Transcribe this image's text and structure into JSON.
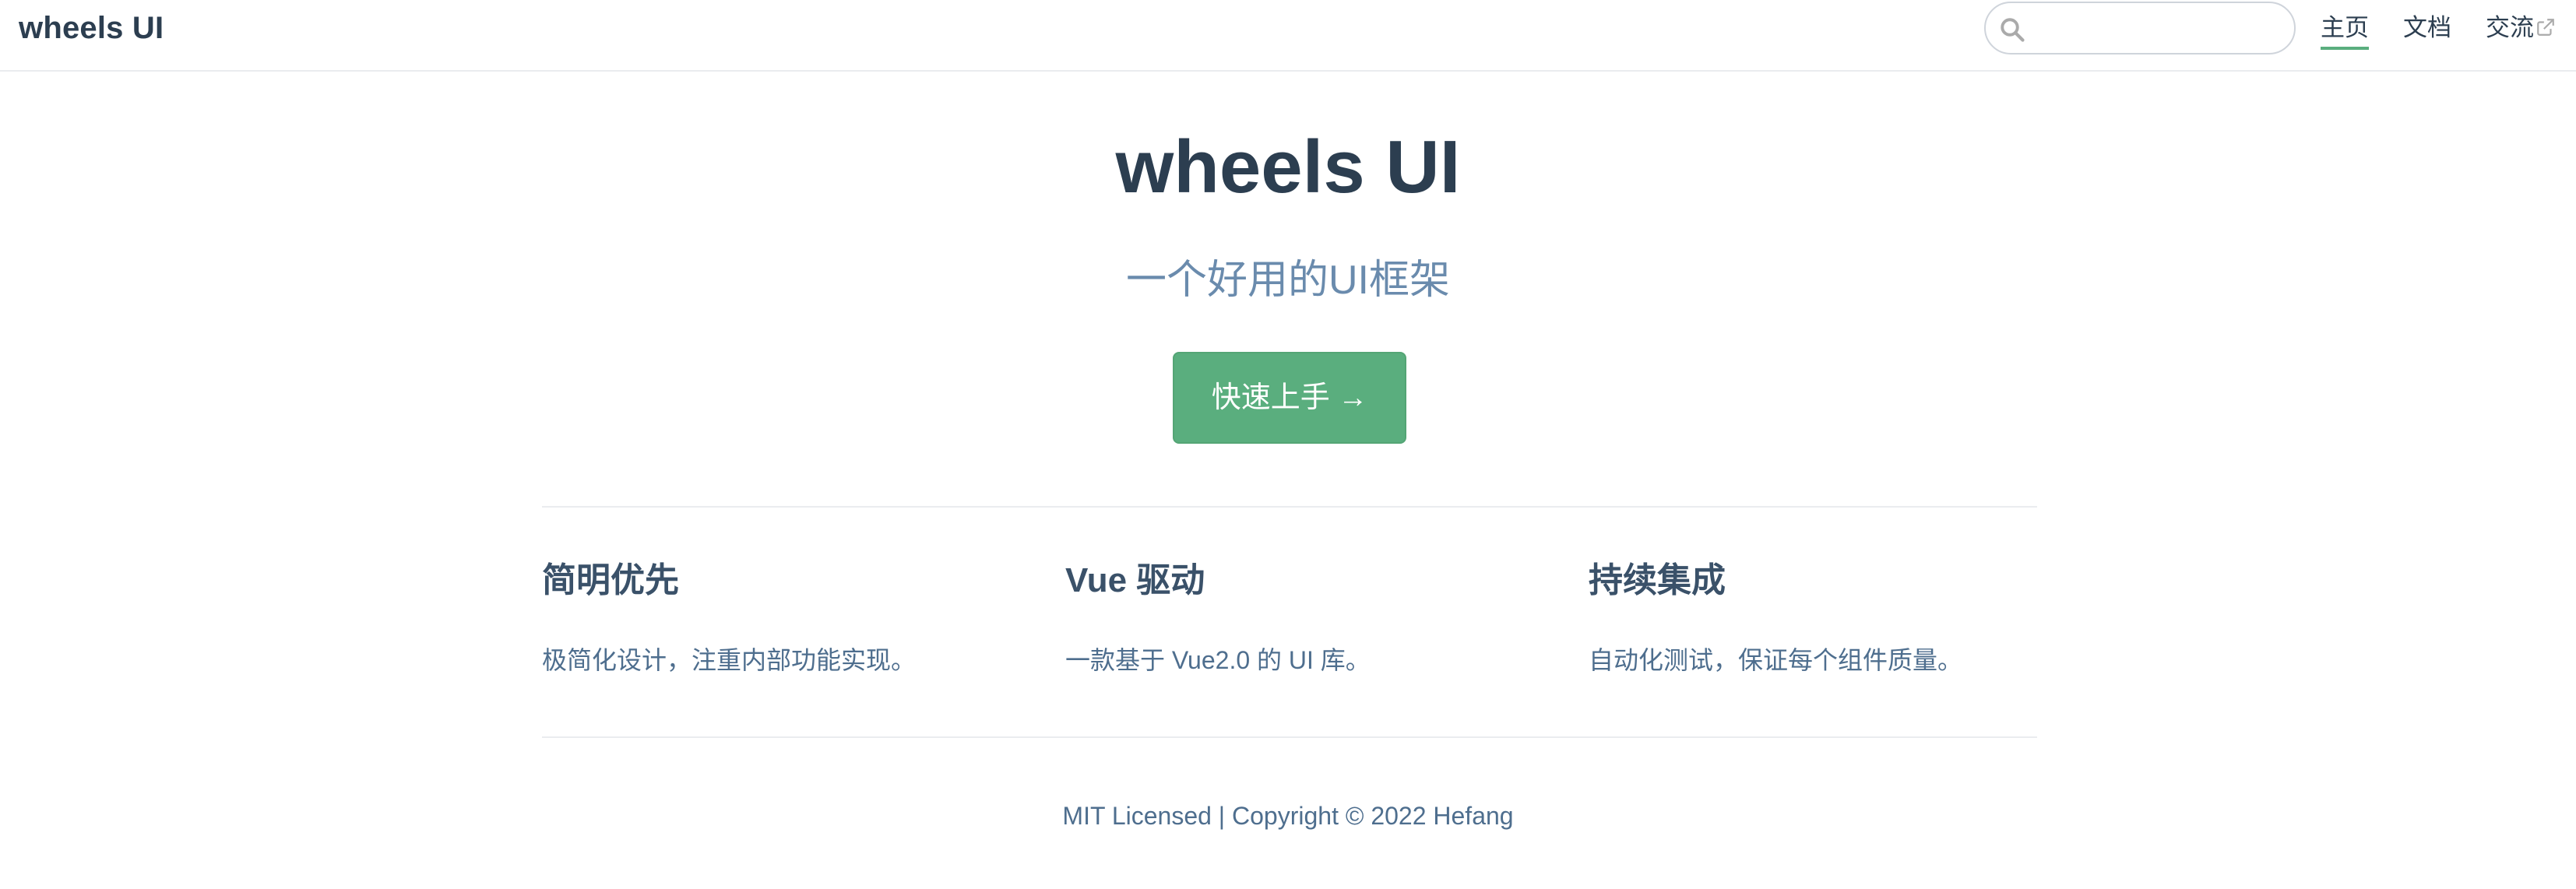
{
  "navbar": {
    "brand": "wheels UI",
    "search": {
      "value": "",
      "placeholder": ""
    },
    "links": [
      {
        "label": "主页",
        "active": true
      },
      {
        "label": "文档",
        "active": false
      },
      {
        "label": "交流",
        "active": false,
        "external": true
      }
    ]
  },
  "hero": {
    "title": "wheels UI",
    "description": "一个好用的UI框架",
    "action_label": "快速上手 →"
  },
  "features": [
    {
      "title": "简明优先",
      "details": "极简化设计，注重内部功能实现。"
    },
    {
      "title": "Vue 驱动",
      "details": "一款基于 Vue2.0 的 UI 库。"
    },
    {
      "title": "持续集成",
      "details": "自动化测试，保证每个组件质量。"
    }
  ],
  "footer": {
    "text": "MIT Licensed | Copyright © 2022 Hefang"
  },
  "colors": {
    "accent": "#5aae7e",
    "text": "#2c3e50",
    "muted": "#6a8bad",
    "border": "#eaecef"
  },
  "icons": {
    "search": "search-icon",
    "external": "external-link-icon"
  }
}
